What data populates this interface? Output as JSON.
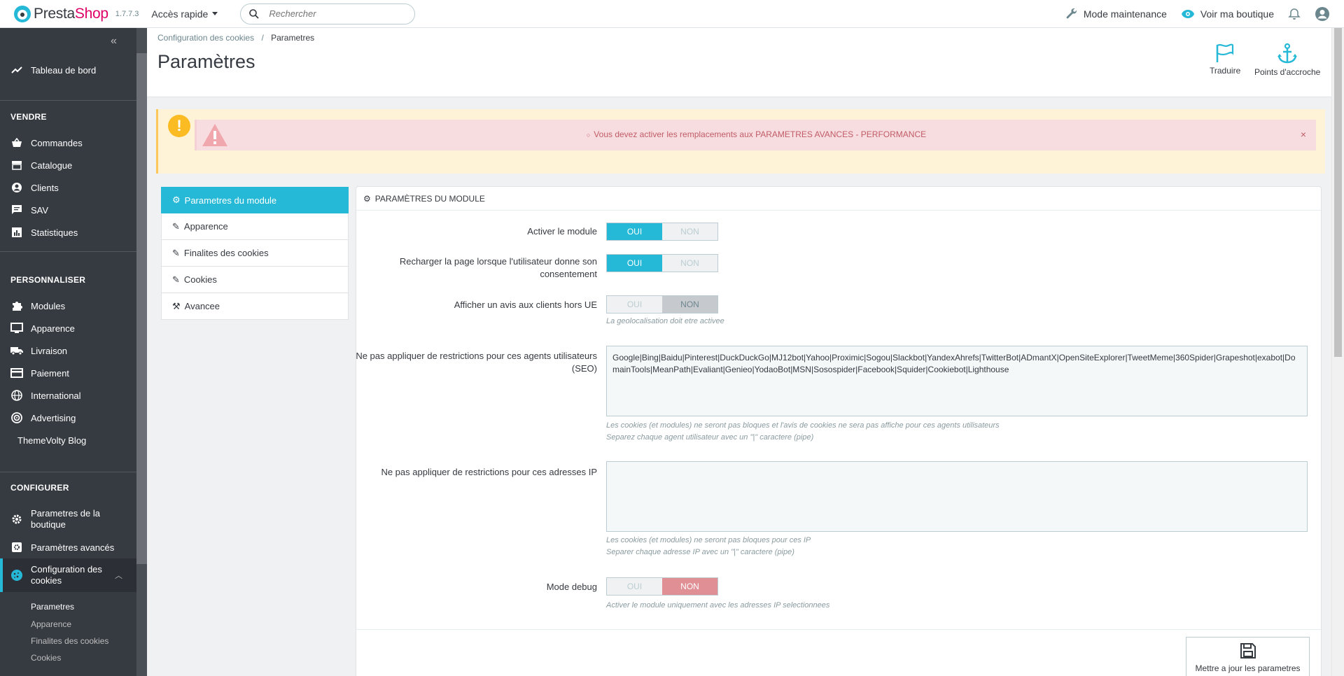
{
  "header": {
    "logo_prefix": "Presta",
    "logo_suffix": "Shop",
    "version": "1.7.7.3",
    "quick_access": "Accès rapide",
    "search_placeholder": "Rechercher",
    "maintenance": "Mode maintenance",
    "view_shop": "Voir ma boutique"
  },
  "sidebar": {
    "dashboard": "Tableau de bord",
    "sell_title": "VENDRE",
    "sell": [
      "Commandes",
      "Catalogue",
      "Clients",
      "SAV",
      "Statistiques"
    ],
    "customize_title": "PERSONNALISER",
    "customize": [
      "Modules",
      "Apparence",
      "Livraison",
      "Paiement",
      "International",
      "Advertising",
      "ThemeVolty Blog"
    ],
    "configure_title": "CONFIGURER",
    "configure": [
      "Parametres de la boutique",
      "Paramètres avancés"
    ],
    "active": "Configuration des cookies",
    "sub": [
      "Parametres",
      "Apparence",
      "Finalites des cookies",
      "Cookies"
    ]
  },
  "page": {
    "breadcrumb_parent": "Configuration des cookies",
    "breadcrumb_sep": "/",
    "breadcrumb_current": "Parametres",
    "title": "Paramètres",
    "translate": "Traduire",
    "hooks": "Points d'accroche"
  },
  "alert": {
    "icon": "!",
    "message": "Vous devez activer les remplacements aux PARAMETRES AVANCES - PERFORMANCE",
    "close": "×"
  },
  "tabs": [
    "Parametres du module",
    "Apparence",
    "Finalites des cookies",
    "Cookies",
    "Avancee"
  ],
  "panel": {
    "heading": "PARAMÈTRES DU MODULE",
    "yes": "OUI",
    "no": "NON",
    "activate_label": "Activer le module",
    "reload_label": "Recharger la page lorsque l'utilisateur donne son consentement",
    "notice_label": "Afficher un avis aux clients hors UE",
    "notice_help": "La geolocalisation doit etre activee",
    "agents_label": "Ne pas appliquer de restrictions pour ces agents utilisateurs (SEO)",
    "agents_value": "Google|Bing|Baidu|Pinterest|DuckDuckGo|MJ12bot|Yahoo|Proximic|Sogou|Slackbot|YandexAhrefs|TwitterBot|ADmantX|OpenSiteExplorer|TweetMeme|360Spider|Grapeshot|exabot|DomainTools|MeanPath|Evaliant|Genieo|YodaoBot|MSN|Sosospider|Facebook|Squider|Cookiebot|Lighthouse",
    "agents_help1": "Les cookies (et modules) ne seront pas bloques et l'avis de cookies ne sera pas affiche pour ces agents utilisateurs",
    "agents_help2": "Separez chaque agent utilisateur avec un \"|\" caractere (pipe)",
    "ip_label": "Ne pas appliquer de restrictions pour ces adresses IP",
    "ip_value": "",
    "ip_help1": "Les cookies (et modules) ne seront pas bloques pour ces IP",
    "ip_help2": "Separer chaque adresse IP avec un \"|\" caractere (pipe)",
    "debug_label": "Mode debug",
    "debug_help": "Activer le module uniquement avec les adresses IP selectionnees",
    "save": "Mettre a jour les parametres"
  },
  "colors": {
    "accent": "#25b9d7",
    "brand_pink": "#df0067",
    "sidebar_bg": "#363a41",
    "danger_text": "#c05c67",
    "debug_no": "#e08f95"
  }
}
